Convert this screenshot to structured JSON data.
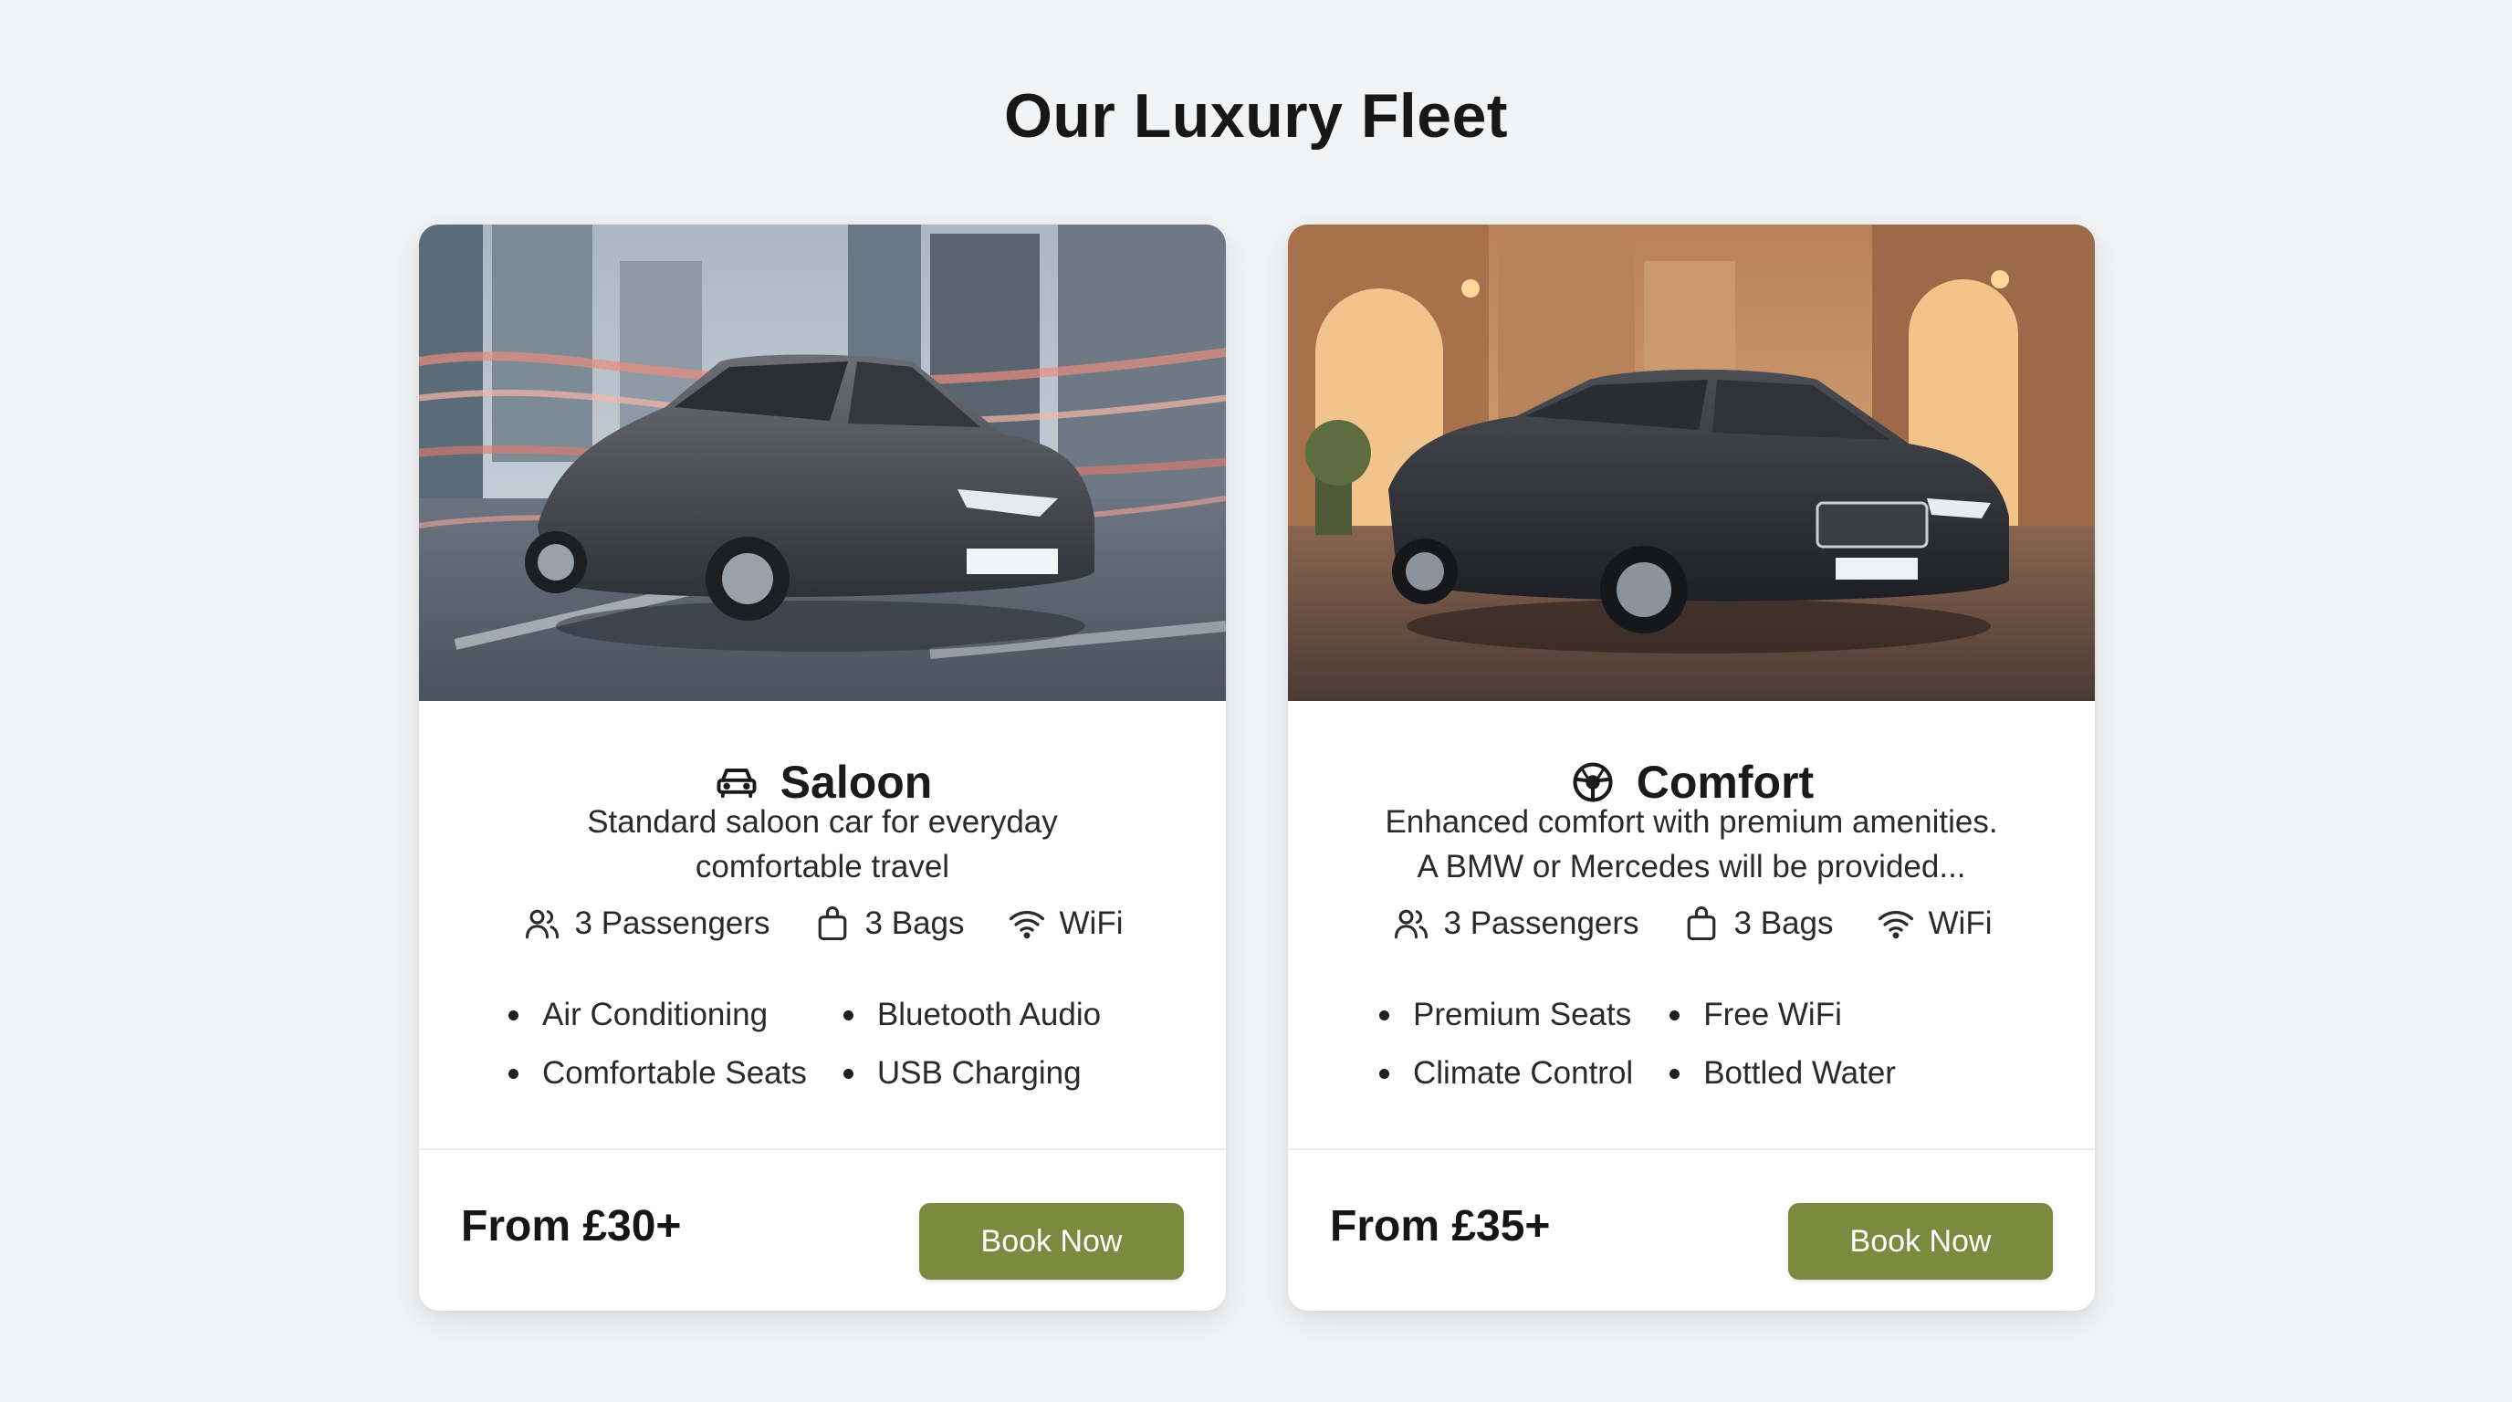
{
  "page": {
    "title": "Our Luxury Fleet"
  },
  "colors": {
    "background": "#f1f3f5",
    "card": "#ffffff",
    "accent_button": "#7b8a3f",
    "text": "#1c1c1c"
  },
  "cards": [
    {
      "icon": "car-icon",
      "title": "Saloon",
      "image": "grey-toyota-prius-city-street",
      "description": [
        "Standard saloon car for everyday",
        "comfortable travel"
      ],
      "specs": {
        "passengers": "3 Passengers",
        "bags": "3 Bags",
        "wifi": "WiFi"
      },
      "features": [
        "Air Conditioning",
        "Bluetooth Audio",
        "Comfortable Seats",
        "USB Charging"
      ],
      "price": "From £30+",
      "button": "Book Now"
    },
    {
      "icon": "steering-wheel-icon",
      "title": "Comfort",
      "image": "black-bmw-sedan-old-town-street",
      "description": [
        "Enhanced comfort with premium amenities.",
        "A BMW or Mercedes will be provided..."
      ],
      "specs": {
        "passengers": "3 Passengers",
        "bags": "3 Bags",
        "wifi": "WiFi"
      },
      "features": [
        "Premium Seats",
        "Free WiFi",
        "Climate Control",
        "Bottled Water"
      ],
      "price": "From £35+",
      "button": "Book Now"
    }
  ]
}
